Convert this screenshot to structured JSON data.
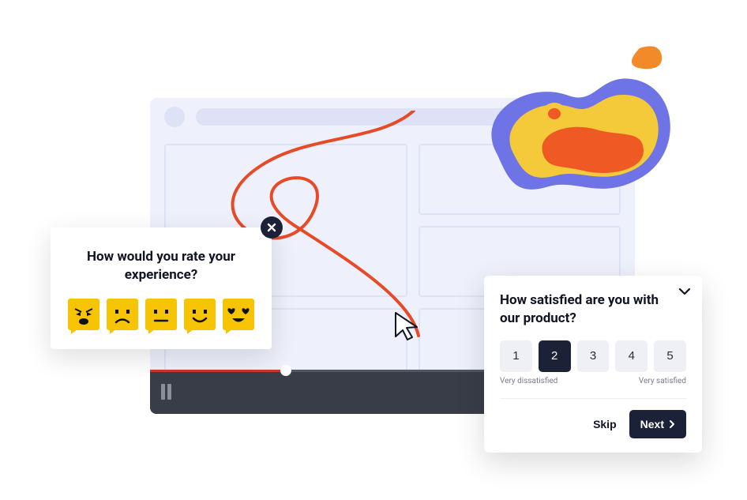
{
  "emoji_survey": {
    "question": "How would you rate your experience?",
    "options": [
      {
        "name": "angry-emoji",
        "label": "Angry"
      },
      {
        "name": "sad-emoji",
        "label": "Sad"
      },
      {
        "name": "neutral-emoji",
        "label": "Neutral"
      },
      {
        "name": "happy-emoji",
        "label": "Happy"
      },
      {
        "name": "love-emoji",
        "label": "Love"
      }
    ],
    "close_label": "Close"
  },
  "nps_survey": {
    "question": "How satisfied are you with our product?",
    "scale": [
      "1",
      "2",
      "3",
      "4",
      "5"
    ],
    "selected_index": 1,
    "low_label": "Very dissatisfied",
    "high_label": "Very satisfied",
    "skip_label": "Skip",
    "next_label": "Next"
  },
  "player": {
    "state": "paused",
    "progress_percent": 28
  },
  "colors": {
    "ink": "#1b2137",
    "accent_yellow": "#f7c403",
    "accent_red": "#e74a27",
    "panel": "#eef0fb"
  }
}
